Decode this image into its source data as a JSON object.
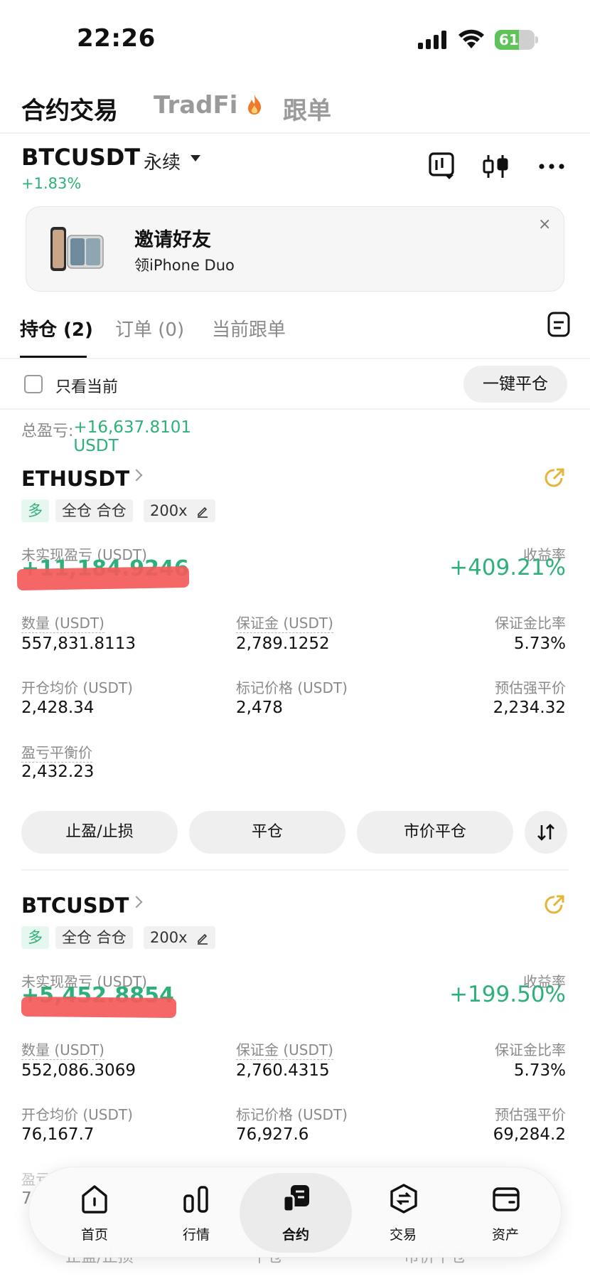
{
  "status_bar": {
    "time": "22:26",
    "battery": "61",
    "battery_level": 0.61
  },
  "top_tabs": [
    {
      "label": "合约交易"
    },
    {
      "label": "TradFi"
    },
    {
      "label": "跟单"
    }
  ],
  "header": {
    "symbol": "BTCUSDT",
    "kind": "永续",
    "change": "+1.83%"
  },
  "banner": {
    "title": "邀请好友",
    "subtitle": "领iPhone Duo",
    "close": "×"
  },
  "sub_tabs": [
    {
      "label": "持仓 (2)"
    },
    {
      "label": "订单 (0)"
    },
    {
      "label": "当前跟单"
    }
  ],
  "filter": {
    "only_current": "只看当前",
    "close_all": "一键平仓"
  },
  "total_pnl": {
    "label": "总盈亏: ",
    "value": "+16,637.8101 USDT"
  },
  "labels": {
    "unrealized": "未实现盈亏 (USDT)",
    "roe": "收益率",
    "qty": "数量 (USDT)",
    "margin": "保证金 (USDT)",
    "margin_ratio": "保证金比率",
    "entry": "开仓均价 (USDT)",
    "mark": "标记价格 (USDT)",
    "liq": "预估强平价",
    "breakeven": "盈亏平衡价"
  },
  "actions": {
    "tpsl": "止盈/止损",
    "close": "平仓",
    "market_close": "市价平仓"
  },
  "positions": [
    {
      "symbol": "ETHUSDT",
      "side": "多",
      "mode": "全仓 合仓",
      "leverage": "200x",
      "pnl": "+11,184.9246",
      "roe": "+409.21%",
      "qty": "557,831.8113",
      "margin": "2,789.1252",
      "margin_ratio": "5.73%",
      "entry": "2,428.34",
      "mark": "2,478",
      "liq": "2,234.32",
      "breakeven": "2,432.23"
    },
    {
      "symbol": "BTCUSDT",
      "side": "多",
      "mode": "全仓 合仓",
      "leverage": "200x",
      "pnl": "+5,452.8854",
      "roe": "+199.50%",
      "qty": "552,086.3069",
      "margin": "2,760.4315",
      "margin_ratio": "5.73%",
      "entry": "76,167.7",
      "mark": "76,927.6",
      "liq": "69,284.2",
      "breakeven_label_partial": "盈亏",
      "breakeven_partial": "7"
    }
  ],
  "bottom_nav": [
    {
      "label": "首页",
      "icon": "home-icon"
    },
    {
      "label": "行情",
      "icon": "market-icon"
    },
    {
      "label": "合约",
      "icon": "futures-icon"
    },
    {
      "label": "交易",
      "icon": "trade-icon"
    },
    {
      "label": "资产",
      "icon": "wallet-icon"
    }
  ],
  "colors": {
    "green": "#2fb07a",
    "redaction": "#f45a5a",
    "accent_yellow": "#e3b53c"
  }
}
